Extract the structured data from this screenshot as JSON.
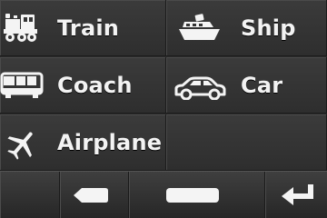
{
  "options": [
    {
      "label": "Train",
      "icon": "train-icon"
    },
    {
      "label": "Ship",
      "icon": "ship-icon"
    },
    {
      "label": "Coach",
      "icon": "bus-icon"
    },
    {
      "label": "Car",
      "icon": "car-icon"
    },
    {
      "label": "Airplane",
      "icon": "airplane-icon"
    }
  ],
  "bottombar": {
    "keys": [
      {
        "icon": "backspace-icon"
      },
      {
        "icon": "space-icon"
      },
      {
        "icon": "enter-icon"
      }
    ]
  },
  "colors": {
    "background": "#262626",
    "cell": "#343434",
    "divider": "#1b1b1b",
    "text": "#f2f2f2"
  }
}
